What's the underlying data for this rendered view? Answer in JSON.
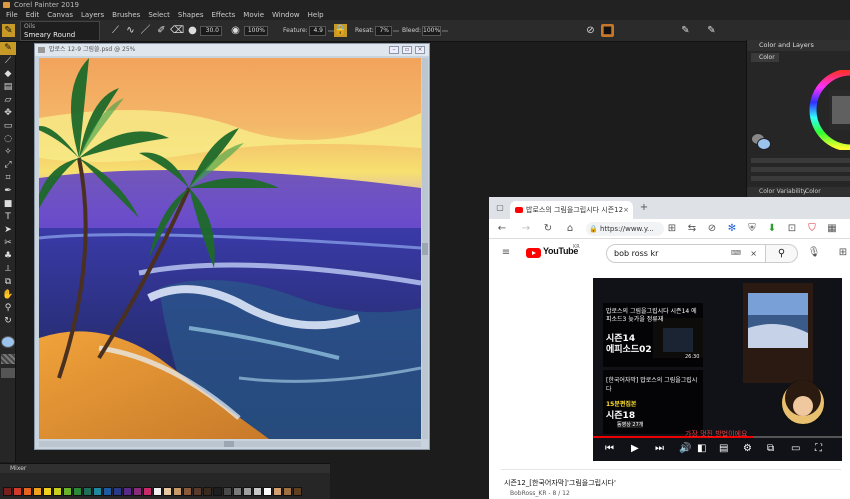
{
  "app": {
    "title": "Corel Painter 2019"
  },
  "menu": [
    "File",
    "Edit",
    "Canvas",
    "Layers",
    "Brushes",
    "Select",
    "Shapes",
    "Effects",
    "Movie",
    "Window",
    "Help"
  ],
  "propbar": {
    "brush_category": "Oils",
    "brush_variant": "Smeary Round",
    "size": "30.0",
    "opacity": "100%",
    "feature_label": "Feature:",
    "feature": "4.9",
    "resat_label": "Resat:",
    "resat": "7%",
    "bleed_label": "Bleed:",
    "bleed": "100%"
  },
  "canvas_window": {
    "title": "밥로스 12-9 그림쓸.psd @ 25%"
  },
  "mixer": {
    "title": "Mixer",
    "colors": [
      "#7a1e1e",
      "#d43a2a",
      "#e8641e",
      "#f2a31e",
      "#f2d21e",
      "#c8d21e",
      "#6ab42a",
      "#2a8a3a",
      "#1e6e5a",
      "#1e8aa0",
      "#1e5aa0",
      "#2a3a8a",
      "#5a2a8a",
      "#8a2a7a",
      "#c82a6a",
      "#f2f2f2",
      "#e8c8a0",
      "#c89a6a",
      "#8a5a3a",
      "#5a3a2a",
      "#3a2a1e",
      "#1e1e1e",
      "#4a4a4a",
      "#7a7a7a",
      "#a0a0a0",
      "#c8c8c8",
      "#ffffff",
      "#d4a070",
      "#a07040",
      "#604020"
    ]
  },
  "right_panel": {
    "title": "Color and Layers",
    "tab": "Color",
    "footer_left": "Color Variability",
    "footer_right": "Color Expression"
  },
  "browser": {
    "tab_title": "밥로스의 그림을그립시다 시즌12",
    "address": "https://www.y...",
    "search_value": "bob ross kr",
    "logo_text": "YouTube",
    "logo_region": "KR",
    "video": {
      "card1_line1": "밥로스의 그림을그립시다 시즌14 에피소드3 늦가을 정류재",
      "card1_season": "시즌14",
      "card1_episode": "에피소드02",
      "card1_duration": "26:30",
      "card2_line1": "[한국어자막] 밥로스의 그림을그립시다",
      "card2_tag": "15분편집본",
      "card2_season": "시즌18",
      "card2_count": "동영상 27개",
      "subtitle": "가장 멋진 방법이에요"
    },
    "video_title": "시즌12_[한국어자막]'그림을그립시다'",
    "video_meta": "BobRoss_KR - 8 / 12"
  },
  "tool_icons": [
    "brush-icon",
    "dropper-icon",
    "paint-bucket-icon",
    "gradient-icon",
    "eraser-icon",
    "move-icon",
    "rect-select-icon",
    "lasso-icon",
    "magic-wand-icon",
    "transform-icon",
    "crop-icon",
    "pen-icon",
    "shape-icon",
    "text-icon",
    "selector-icon",
    "cloner-icon",
    "stamp-icon",
    "perspective-icon",
    "mirror-icon",
    "grabber-icon",
    "zoom-icon",
    "rotate-icon"
  ]
}
